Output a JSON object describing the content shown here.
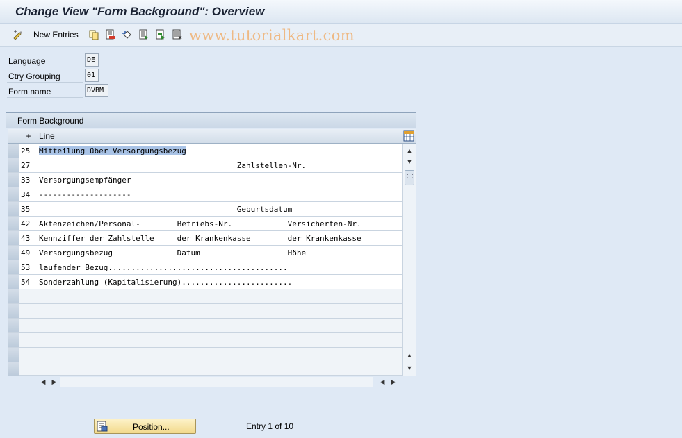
{
  "title": "Change View \"Form Background\": Overview",
  "toolbar": {
    "new_entries": "New Entries",
    "watermark": "www.tutorialkart.com"
  },
  "fields": [
    {
      "label": "Language",
      "value": "DE"
    },
    {
      "label": "Ctry Grouping",
      "value": "01"
    },
    {
      "label": "Form name",
      "value": "DVBM"
    }
  ],
  "panel": {
    "title": "Form Background",
    "columns": {
      "plus": "+",
      "line": "Line"
    },
    "rows": [
      {
        "num": "25",
        "text": "Mitteilung über Versorgungsbezug"
      },
      {
        "num": "27",
        "text": "                                           Zahlstellen-Nr."
      },
      {
        "num": "33",
        "text": "Versorgungsempfänger"
      },
      {
        "num": "34",
        "text": "--------------------"
      },
      {
        "num": "35",
        "text": "                                           Geburtsdatum"
      },
      {
        "num": "42",
        "text": "Aktenzeichen/Personal-        Betriebs-Nr.            Versicherten-Nr."
      },
      {
        "num": "43",
        "text": "Kennziffer der Zahlstelle     der Krankenkasse        der Krankenkasse"
      },
      {
        "num": "49",
        "text": "Versorgungsbezug              Datum                   Höhe"
      },
      {
        "num": "53",
        "text": "laufender Bezug......................................."
      },
      {
        "num": "54",
        "text": "Sonderzahlung (Kapitalisierung)........................"
      }
    ]
  },
  "footer": {
    "position_button": "Position...",
    "entry_info": "Entry 1 of 10"
  }
}
